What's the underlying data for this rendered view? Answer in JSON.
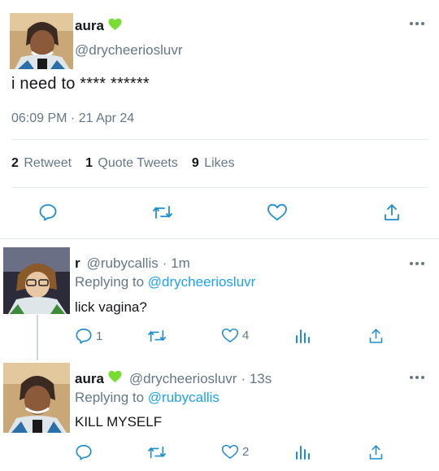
{
  "main_tweet": {
    "display_name": "aura",
    "badge_icon": "green-heart-icon",
    "handle": "@drycheeriosluvr",
    "text": "i need to **** ******",
    "timestamp": "06:09 PM · 21 Apr 24",
    "stats": {
      "retweets_count": "2",
      "retweets_label": "Retweet",
      "quotes_count": "1",
      "quotes_label": "Quote Tweets",
      "likes_count": "9",
      "likes_label": "Likes"
    }
  },
  "replies": [
    {
      "display_name": "r",
      "handle": "@rubycallis",
      "time": "· 1m",
      "replying_prefix": "Replying to",
      "replying_to": "@drycheeriosluvr",
      "text": "lick vagina?",
      "reply_count": "1",
      "like_count": "4"
    },
    {
      "display_name": "aura",
      "badge_icon": "green-heart-icon",
      "handle": "@drycheeriosluvr",
      "time": "· 13s",
      "replying_prefix": "Replying to",
      "replying_to": "@rubycallis",
      "text": "KILL MYSELF",
      "like_count": "2"
    }
  ],
  "colors": {
    "accent_link": "#1da1f2",
    "muted_text": "#657786",
    "icon_blue": "#1d8ecf",
    "divider": "#e6ecf0",
    "heart_badge": "#77dd33"
  }
}
